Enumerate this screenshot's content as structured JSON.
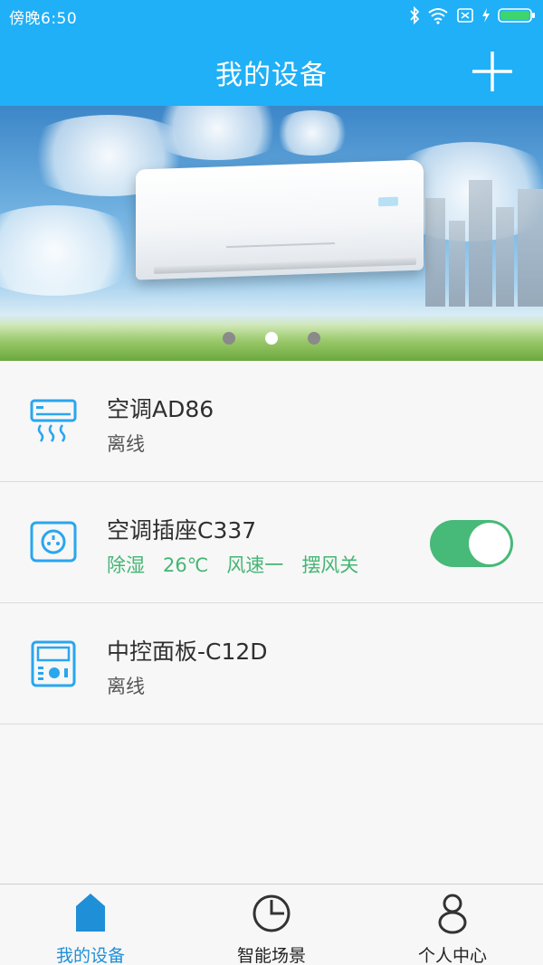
{
  "status_bar": {
    "time": "傍晚6:50"
  },
  "header": {
    "title": "我的设备"
  },
  "banner": {
    "page_count": 3,
    "active_index": 1
  },
  "devices": [
    {
      "name": "空调AD86",
      "status": "离线",
      "icon": "air-conditioner-icon"
    },
    {
      "name": "空调插座C337",
      "tags": [
        "除湿",
        "26℃",
        "风速一",
        "摆风关"
      ],
      "icon": "socket-icon",
      "switch_on": true,
      "accent": "#45b574"
    },
    {
      "name": "中控面板-C12D",
      "status": "离线",
      "icon": "control-panel-icon"
    }
  ],
  "bottom_nav": {
    "tabs": [
      {
        "label": "我的设备",
        "icon": "home-icon",
        "active": true
      },
      {
        "label": "智能场景",
        "icon": "clock-icon",
        "active": false
      },
      {
        "label": "个人中心",
        "icon": "person-icon",
        "active": false
      }
    ],
    "accent": "#1f8fd8"
  },
  "colors": {
    "primary": "#1fb0f7",
    "icon_blue": "#29a6ee",
    "switch_green": "#47b978"
  }
}
